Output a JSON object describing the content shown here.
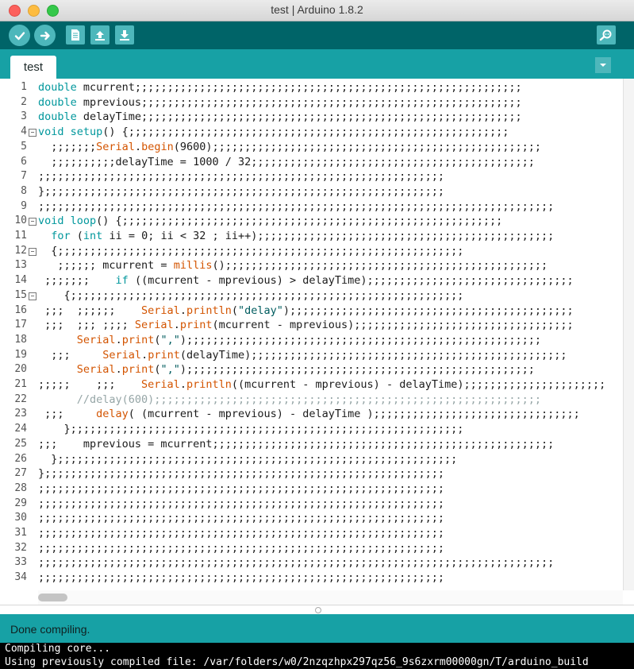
{
  "window": {
    "title": "test | Arduino 1.8.2"
  },
  "toolbar": {
    "buttons": [
      {
        "name": "verify",
        "icon": "check-icon"
      },
      {
        "name": "upload",
        "icon": "arrow-right-icon"
      },
      {
        "name": "new",
        "icon": "document-icon"
      },
      {
        "name": "open",
        "icon": "arrow-up-icon"
      },
      {
        "name": "save",
        "icon": "arrow-down-icon"
      },
      {
        "name": "serial-monitor",
        "icon": "magnifier-icon"
      }
    ]
  },
  "tabs": [
    {
      "label": "test"
    }
  ],
  "editor": {
    "lines": [
      "double mcurrent;;;;;;;;;;;;;;;;;;;;;;;;;;;;;;;;;;;;;;;;;;;;;;;;;;;;;;;;;;;;",
      "double mprevious;;;;;;;;;;;;;;;;;;;;;;;;;;;;;;;;;;;;;;;;;;;;;;;;;;;;;;;;;;;",
      "double delayTime;;;;;;;;;;;;;;;;;;;;;;;;;;;;;;;;;;;;;;;;;;;;;;;;;;;;;;;;;;;",
      "void setup() {;;;;;;;;;;;;;;;;;;;;;;;;;;;;;;;;;;;;;;;;;;;;;;;;;;;;;;;;;;;",
      "  ;;;;;;;Serial.begin(9600);;;;;;;;;;;;;;;;;;;;;;;;;;;;;;;;;;;;;;;;;;;;;;;;;;;",
      "  ;;;;;;;;;;delayTime = 1000 / 32;;;;;;;;;;;;;;;;;;;;;;;;;;;;;;;;;;;;;;;;;;;;",
      ";;;;;;;;;;;;;;;;;;;;;;;;;;;;;;;;;;;;;;;;;;;;;;;;;;;;;;;;;;;;;;;",
      "};;;;;;;;;;;;;;;;;;;;;;;;;;;;;;;;;;;;;;;;;;;;;;;;;;;;;;;;;;;;;;",
      ";;;;;;;;;;;;;;;;;;;;;;;;;;;;;;;;;;;;;;;;;;;;;;;;;;;;;;;;;;;;;;;;;;;;;;;;;;;;;;;;",
      "void loop() {;;;;;;;;;;;;;;;;;;;;;;;;;;;;;;;;;;;;;;;;;;;;;;;;;;;;;;;;;;;",
      "  for (int ii = 0; ii < 32 ; ii++);;;;;;;;;;;;;;;;;;;;;;;;;;;;;;;;;;;;;;;;;;;;;;",
      "  {;;;;;;;;;;;;;;;;;;;;;;;;;;;;;;;;;;;;;;;;;;;;;;;;;;;;;;;;;;;;;;;",
      "   ;;;;;; mcurrent = millis();;;;;;;;;;;;;;;;;;;;;;;;;;;;;;;;;;;;;;;;;;;;;;;;;;",
      " ;;;;;;;    if ((mcurrent - mprevious) > delayTime);;;;;;;;;;;;;;;;;;;;;;;;;;;;;;;;",
      "    {;;;;;;;;;;;;;;;;;;;;;;;;;;;;;;;;;;;;;;;;;;;;;;;;;;;;;;;;;;;;;",
      " ;;;  ;;;;;;    Serial.println(\"delay\");;;;;;;;;;;;;;;;;;;;;;;;;;;;;;;;;;;;;;;;;;;;",
      " ;;;  ;;; ;;;; Serial.print(mcurrent - mprevious);;;;;;;;;;;;;;;;;;;;;;;;;;;;;;;;;;",
      "      Serial.print(\",\");;;;;;;;;;;;;;;;;;;;;;;;;;;;;;;;;;;;;;;;;;;;;;;;;;;;;;;",
      "  ;;;     Serial.print(delayTime);;;;;;;;;;;;;;;;;;;;;;;;;;;;;;;;;;;;;;;;;;;;;;;;;",
      "      Serial.print(\",\");;;;;;;;;;;;;;;;;;;;;;;;;;;;;;;;;;;;;;;;;;;;;;;;;;;;;;",
      ";;;;;    ;;;    Serial.println((mcurrent - mprevious) - delayTime);;;;;;;;;;;;;;;;;;;;;;",
      "      //delay(600);;;;;;;;;;;;;;;;;;;;;;;;;;;;;;;;;;;;;;;;;;;;;;;;;;;;;;;;;;;;",
      " ;;;     delay( (mcurrent - mprevious) - delayTime );;;;;;;;;;;;;;;;;;;;;;;;;;;;;;;;",
      "    };;;;;;;;;;;;;;;;;;;;;;;;;;;;;;;;;;;;;;;;;;;;;;;;;;;;;;;;;;;;;",
      ";;;    mprevious = mcurrent;;;;;;;;;;;;;;;;;;;;;;;;;;;;;;;;;;;;;;;;;;;;;;;;;;;;;",
      "  };;;;;;;;;;;;;;;;;;;;;;;;;;;;;;;;;;;;;;;;;;;;;;;;;;;;;;;;;;;;;;",
      "};;;;;;;;;;;;;;;;;;;;;;;;;;;;;;;;;;;;;;;;;;;;;;;;;;;;;;;;;;;;;;",
      ";;;;;;;;;;;;;;;;;;;;;;;;;;;;;;;;;;;;;;;;;;;;;;;;;;;;;;;;;;;;;;;",
      ";;;;;;;;;;;;;;;;;;;;;;;;;;;;;;;;;;;;;;;;;;;;;;;;;;;;;;;;;;;;;;;",
      ";;;;;;;;;;;;;;;;;;;;;;;;;;;;;;;;;;;;;;;;;;;;;;;;;;;;;;;;;;;;;;;",
      ";;;;;;;;;;;;;;;;;;;;;;;;;;;;;;;;;;;;;;;;;;;;;;;;;;;;;;;;;;;;;;;",
      ";;;;;;;;;;;;;;;;;;;;;;;;;;;;;;;;;;;;;;;;;;;;;;;;;;;;;;;;;;;;;;;",
      ";;;;;;;;;;;;;;;;;;;;;;;;;;;;;;;;;;;;;;;;;;;;;;;;;;;;;;;;;;;;;;;;;;;;;;;;;;;;;;;;",
      ";;;;;;;;;;;;;;;;;;;;;;;;;;;;;;;;;;;;;;;;;;;;;;;;;;;;;;;;;;;;;;;"
    ],
    "fold_lines": [
      4,
      10,
      12,
      15
    ]
  },
  "status": {
    "message": "Done compiling."
  },
  "console": {
    "lines": [
      "Compiling core...",
      "Using previously compiled file: /var/folders/w0/2nzqzhpx297qz56_9s6zxrm00000gn/T/arduino_build"
    ]
  },
  "colors": {
    "toolbar": "#006468",
    "tabstrip": "#17a1a5",
    "button": "#4db7bb",
    "keyword": "#00979c",
    "function": "#d35400"
  }
}
